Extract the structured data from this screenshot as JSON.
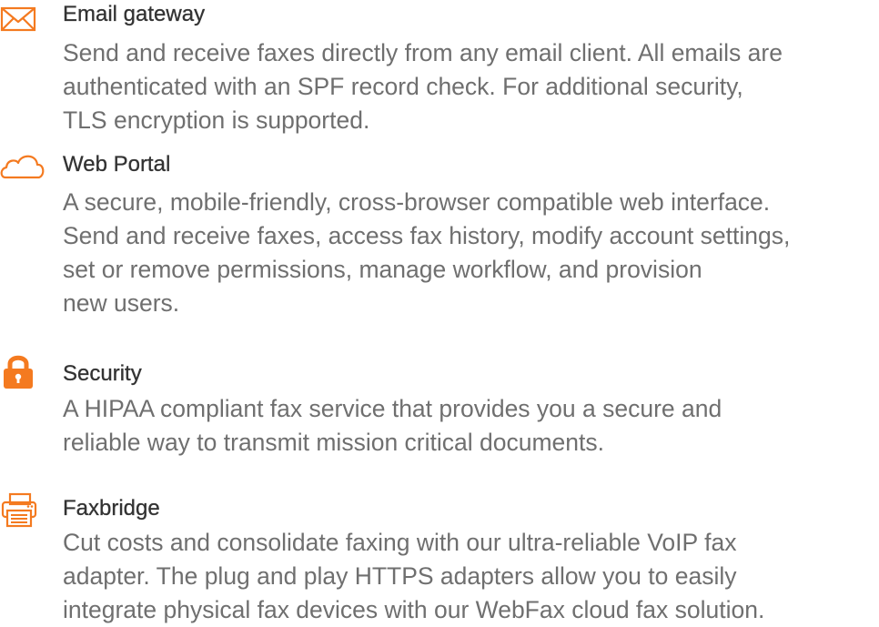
{
  "accent_color": "#f47a20",
  "features": [
    {
      "icon": "envelope-icon",
      "title": "Email gateway",
      "description": "Send and receive faxes directly from any email client. All emails are\nauthenticated with an SPF record check. For additional security,\nTLS encryption is supported."
    },
    {
      "icon": "cloud-icon",
      "title": "Web Portal",
      "description": "A secure, mobile-friendly, cross-browser compatible web interface.\nSend and receive faxes, access fax history, modify account settings,\nset or remove permissions, manage workflow, and provision\nnew users."
    },
    {
      "icon": "lock-icon",
      "title": "Security",
      "description": "A HIPAA compliant fax service that provides you a secure and\nreliable way to transmit mission critical documents."
    },
    {
      "icon": "fax-machine-icon",
      "title": "Faxbridge",
      "description": "Cut costs and consolidate faxing with our ultra-reliable VoIP fax\nadapter. The plug and play HTTPS adapters allow you to easily\nintegrate physical fax devices with our WebFax cloud fax solution."
    }
  ]
}
